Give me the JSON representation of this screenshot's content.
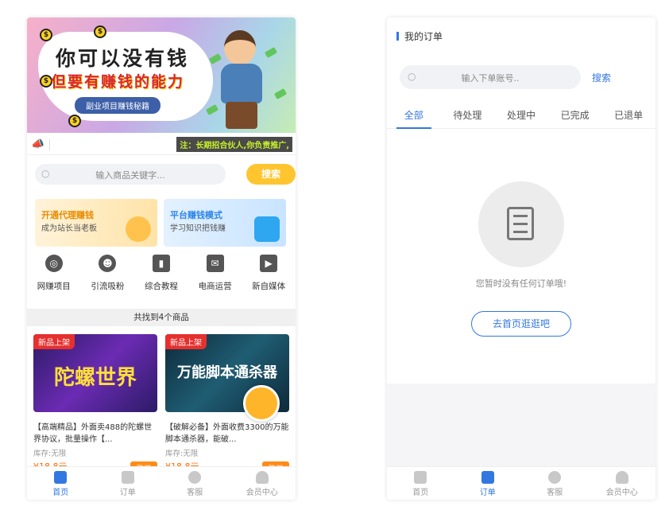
{
  "left": {
    "banner": {
      "title1": "你可以没有钱",
      "title2": "但要有赚钱的能力",
      "pill": "副业项目赚钱秘籍",
      "coin": "$"
    },
    "notice": {
      "icon": "megaphone-icon",
      "text": "注：长期招合伙人,你负责推广,"
    },
    "search": {
      "placeholder": "输入商品关键字...",
      "button": "搜索"
    },
    "promos": [
      {
        "title": "开通代理赚钱",
        "subtitle": "成为站长当老板"
      },
      {
        "title": "平台赚钱模式",
        "subtitle": "学习知识把钱赚"
      }
    ],
    "categories": [
      {
        "icon": "globe-icon",
        "label": "网赚项目"
      },
      {
        "icon": "user-icon",
        "label": "引流吸粉"
      },
      {
        "icon": "book-icon",
        "label": "综合教程"
      },
      {
        "icon": "mail-icon",
        "label": "电商运营"
      },
      {
        "icon": "video-icon",
        "label": "新自媒体"
      }
    ],
    "found_text": "共找到4个商品",
    "products": [
      {
        "badge": "新品上架",
        "image_text": "陀螺世界",
        "name": "【高端精品】外面卖488的陀螺世界协议，批量操作【...",
        "stock": "库存:无限",
        "price": "¥18.8元",
        "buy": "购买"
      },
      {
        "badge": "新品上架",
        "image_text": "万能脚本通杀器",
        "name": "【破解必备】外面收费3300的万能脚本通杀器，能破...",
        "stock": "库存:无限",
        "price": "¥18.8元",
        "buy": "购买"
      }
    ],
    "tabbar": [
      {
        "icon": "home-icon",
        "label": "首页",
        "active": true
      },
      {
        "icon": "order-icon",
        "label": "订单",
        "active": false
      },
      {
        "icon": "service-icon",
        "label": "客服",
        "active": false
      },
      {
        "icon": "member-icon",
        "label": "会员中心",
        "active": false
      }
    ]
  },
  "right": {
    "header_title": "我的订单",
    "search": {
      "placeholder": "输入下单账号..",
      "button": "搜索"
    },
    "tabs": [
      "全部",
      "待处理",
      "处理中",
      "已完成",
      "已退单"
    ],
    "active_tab": "全部",
    "empty_icon": "document-icon",
    "empty_text": "您暂时没有任何订单哦!",
    "home_button": "去首页逛逛吧",
    "tabbar": [
      {
        "icon": "home-icon",
        "label": "首页",
        "active": false
      },
      {
        "icon": "order-icon",
        "label": "订单",
        "active": true
      },
      {
        "icon": "service-icon",
        "label": "客服",
        "active": false
      },
      {
        "icon": "member-icon",
        "label": "会员中心",
        "active": false
      }
    ]
  },
  "colors": {
    "accent_blue": "#3377e0",
    "search_yellow": "#ffc52f",
    "badge_red": "#e5302e",
    "price_orange": "#ff6a00"
  }
}
